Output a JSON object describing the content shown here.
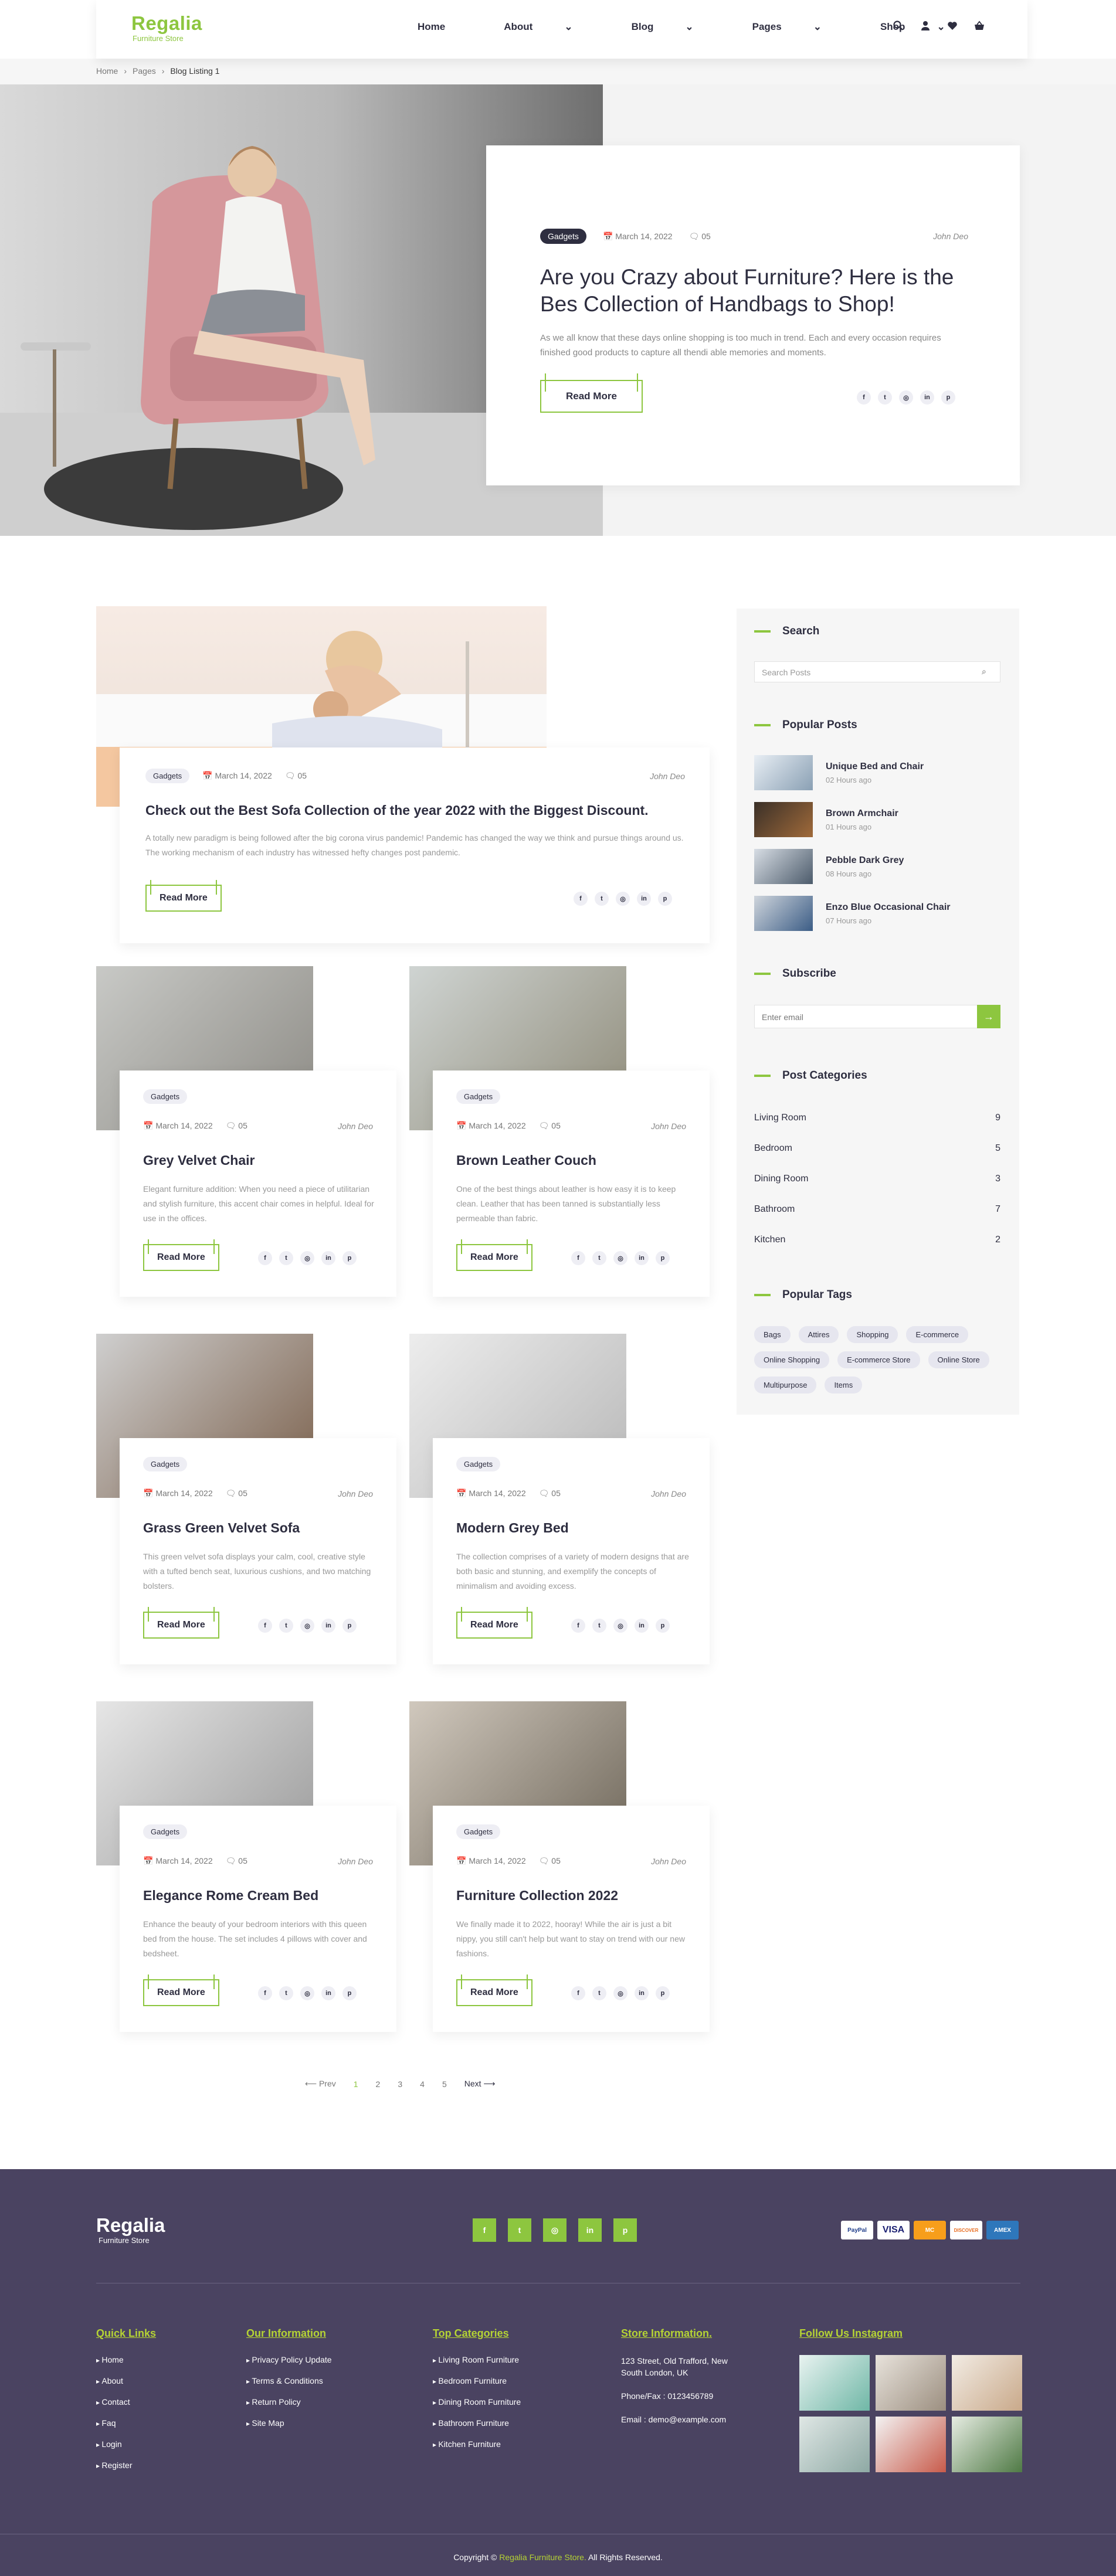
{
  "header": {
    "logo_title": "Regalia",
    "logo_sub": "Furniture Store",
    "nav": [
      {
        "label": "Home"
      },
      {
        "label": "About"
      },
      {
        "label": "Blog"
      },
      {
        "label": "Pages"
      },
      {
        "label": "Shop"
      }
    ]
  },
  "breadcrumb": [
    "Home",
    "Pages",
    "Blog Listing 1"
  ],
  "hero": {
    "badge": "Gadgets",
    "date": "March 14, 2022",
    "comments": "05",
    "author": "John Deo",
    "title": "Are you Crazy about Furniture? Here is the Bes Collection of Handbags to Shop!",
    "desc": "As we all know that these days online shopping is too much in trend. Each and every occasion requires finished good products to capture all thendi able memories and moments.",
    "read_more": "Read More"
  },
  "featured": {
    "badge": "Gadgets",
    "date": "March 14, 2022",
    "comments": "05",
    "author": "John Deo",
    "title": "Check out the Best Sofa Collection of the year 2022 with the Biggest Discount.",
    "desc": "A totally new paradigm is being followed after the big corona virus pandemic! Pandemic has changed the way we think and pursue things around us. The working mechanism of each industry has witnessed hefty changes post pandemic.",
    "read_more": "Read More"
  },
  "posts": [
    {
      "badge": "Gadgets",
      "date": "March 14, 2022",
      "comments": "05",
      "author": "John Deo",
      "title": "Grey Velvet Chair",
      "desc": "Elegant furniture addition: When you need a piece of utilitarian and stylish furniture, this accent chair comes in helpful. Ideal for use in the offices.",
      "read_more": "Read More"
    },
    {
      "badge": "Gadgets",
      "date": "March 14, 2022",
      "comments": "05",
      "author": "John Deo",
      "title": "Brown Leather Couch",
      "desc": "One of the best things about leather is how easy it is to keep clean. Leather that has been tanned is substantially less permeable than fabric.",
      "read_more": "Read More"
    },
    {
      "badge": "Gadgets",
      "date": "March 14, 2022",
      "comments": "05",
      "author": "John Deo",
      "title": "Grass Green Velvet Sofa",
      "desc": "This green velvet sofa displays your calm, cool, creative style with a tufted bench seat, luxurious cushions, and two matching bolsters.",
      "read_more": "Read More"
    },
    {
      "badge": "Gadgets",
      "date": "March 14, 2022",
      "comments": "05",
      "author": "John Deo",
      "title": "Modern Grey Bed",
      "desc": "The collection comprises of a variety of modern designs that are both basic and stunning, and exemplify the concepts of minimalism and avoiding excess.",
      "read_more": "Read More"
    },
    {
      "badge": "Gadgets",
      "date": "March 14, 2022",
      "comments": "05",
      "author": "John Deo",
      "title": "Elegance Rome Cream Bed",
      "desc": "Enhance the beauty of your bedroom interiors with this queen bed from the house. The set includes 4 pillows with cover and bedsheet.",
      "read_more": "Read More"
    },
    {
      "badge": "Gadgets",
      "date": "March 14, 2022",
      "comments": "05",
      "author": "John Deo",
      "title": "Furniture Collection 2022",
      "desc": "We finally made it to 2022, hooray! While the air is just a bit nippy, you still can't help but want to stay on trend with our new fashions.",
      "read_more": "Read More"
    }
  ],
  "sidebar": {
    "search_title": "Search",
    "search_placeholder": "Search Posts",
    "popular_title": "Popular Posts",
    "popular": [
      {
        "name": "Unique Bed and Chair",
        "ago": "02 Hours ago"
      },
      {
        "name": "Brown Armchair",
        "ago": "01 Hours ago"
      },
      {
        "name": "Pebble Dark Grey",
        "ago": "08 Hours ago"
      },
      {
        "name": "Enzo Blue Occasional Chair",
        "ago": "07 Hours ago"
      }
    ],
    "subscribe_title": "Subscribe",
    "subscribe_placeholder": "Enter email",
    "categories_title": "Post Categories",
    "categories": [
      {
        "name": "Living Room",
        "count": "9"
      },
      {
        "name": "Bedroom",
        "count": "5"
      },
      {
        "name": "Dining Room",
        "count": "3"
      },
      {
        "name": "Bathroom",
        "count": "7"
      },
      {
        "name": "Kitchen",
        "count": "2"
      }
    ],
    "tags_title": "Popular Tags",
    "tags": [
      "Bags",
      "Attires",
      "Shopping",
      "E-commerce",
      "Online Shopping",
      "E-commerce Store",
      "Online Store",
      "Multipurpose",
      "Items"
    ]
  },
  "pagination": {
    "prev": "⟵ Prev",
    "pages": [
      "1",
      "2",
      "3",
      "4",
      "5"
    ],
    "next": "Next ⟶"
  },
  "footer": {
    "logo_title": "Regalia",
    "logo_sub": "Furniture Store",
    "payments": [
      "PayPal",
      "VISA",
      "MC",
      "DISCOVER",
      "AMEX"
    ],
    "quick_title": "Quick Links",
    "quick": [
      "Home",
      "About",
      "Contact",
      "Faq",
      "Login",
      "Register"
    ],
    "info_title": "Our Information",
    "info": [
      "Privacy Policy Update",
      "Terms & Conditions",
      "Return Policy",
      "Site Map"
    ],
    "cat_title": "Top Categories",
    "cats": [
      "Living Room Furniture",
      "Bedroom Furniture",
      "Dining Room Furniture",
      "Bathroom Furniture",
      "Kitchen Furniture"
    ],
    "store_title": "Store Information.",
    "address": "123 Street, Old Trafford, New South London, UK",
    "phone": "Phone/Fax : 0123456789",
    "email": "Email : demo@example.com",
    "insta_title": "Follow Us Instagram",
    "copy_prefix": "Copyright ©",
    "copy_brand": "Regalia Furniture Store.",
    "copy_suffix": "All Rights Reserved."
  },
  "colors": {
    "accent": "#8dc63f",
    "footer_bg": "#4a4361",
    "dark": "#2e2e40"
  }
}
